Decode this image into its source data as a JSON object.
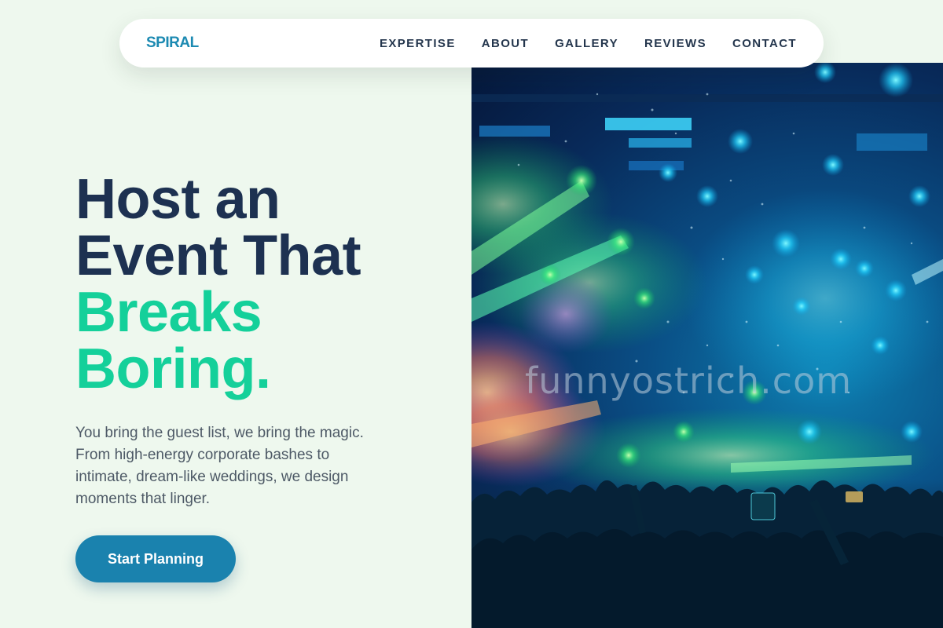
{
  "nav": {
    "logo": "SPIRAL",
    "links": [
      "EXPERTISE",
      "ABOUT",
      "GALLERY",
      "REVIEWS",
      "CONTACT"
    ]
  },
  "hero": {
    "headline_line1": "Host an",
    "headline_line2": "Event That",
    "headline_accent1": "Breaks",
    "headline_accent2": "Boring.",
    "subtext": "You bring the guest list, we bring the magic. From high-energy corporate bashes to intimate, dream-like weddings, we design moments that linger.",
    "cta_label": "Start Planning"
  },
  "image": {
    "watermark": "funnyostrich.com"
  },
  "colors": {
    "background": "#eef8ee",
    "brand": "#1c8ab2",
    "headline": "#1d3151",
    "accent": "#14d09a",
    "cta": "#1a82ae"
  }
}
